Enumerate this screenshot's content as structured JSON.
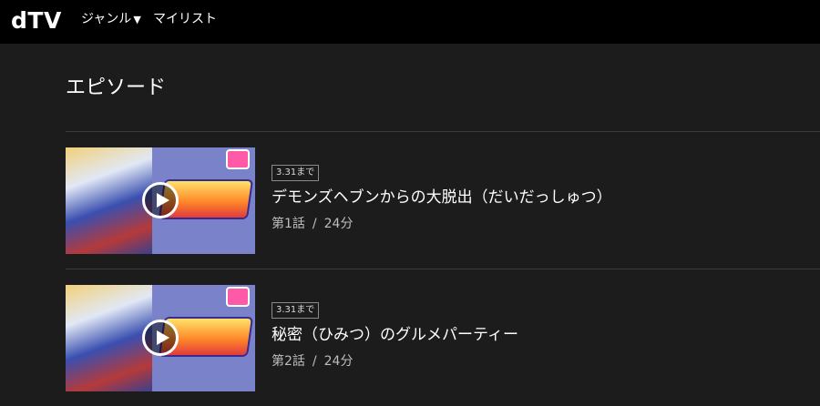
{
  "header": {
    "logo": "dTV",
    "nav": {
      "genre_label": "ジャンル",
      "genre_caret": "▼",
      "mylist_label": "マイリスト"
    }
  },
  "section": {
    "title": "エピソード"
  },
  "episodes": [
    {
      "badge": "3.31まで",
      "title": "デモンズヘブンからの大脱出（だいだっしゅつ）",
      "number": "第1話",
      "separator": "/",
      "duration": "24分"
    },
    {
      "badge": "3.31まで",
      "title": "秘密（ひみつ）のグルメパーティー",
      "number": "第2話",
      "separator": "/",
      "duration": "24分"
    }
  ],
  "colors": {
    "header_bg": "#000000",
    "page_bg": "#1c1c1c",
    "divider": "#3a3a3a",
    "text_primary": "#ffffff",
    "text_secondary": "#bdbdbd"
  }
}
